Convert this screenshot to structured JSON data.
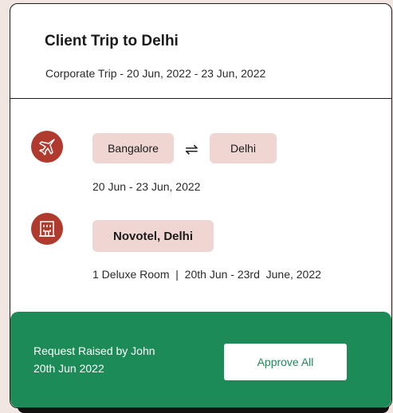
{
  "trip": {
    "title": "Client Trip to Delhi",
    "subtitle": "Corporate Trip - 20 Jun, 2022 - 23 Jun, 2022"
  },
  "flight": {
    "icon": "airplane-icon",
    "from": "Bangalore",
    "swap_symbol": "⇌",
    "to": "Delhi",
    "dates": "20 Jun - 23 Jun, 2022"
  },
  "hotel": {
    "icon": "hotel-icon",
    "name": "Novotel, Delhi",
    "details": "1 Deluxe Room  |  20th Jun - 23rd  June, 2022"
  },
  "request": {
    "line1": "Request Raised by John",
    "line2": "20th Jun 2022",
    "approve_label": "Approve All"
  },
  "colors": {
    "page_bg": "#f1e6e2",
    "accent_red": "#b03a2e",
    "pill_bg": "#f0d6d2",
    "footer_green": "#1c8b57"
  }
}
